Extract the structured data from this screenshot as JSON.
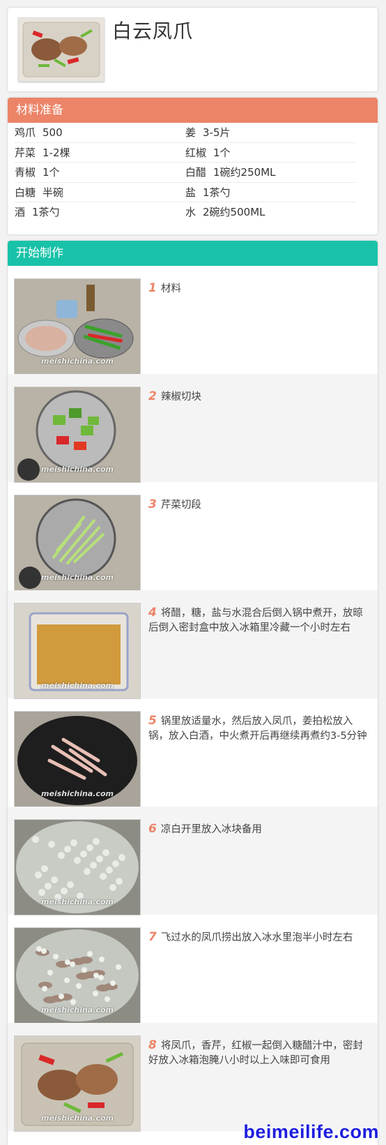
{
  "recipe": {
    "title": "白云凤爪"
  },
  "ingredients": {
    "heading": "材料准备",
    "rows": [
      [
        {
          "name": "鸡爪",
          "amount": "500"
        },
        {
          "name": "姜",
          "amount": "3-5片"
        }
      ],
      [
        {
          "name": "芹菜",
          "amount": "1-2棵"
        },
        {
          "name": "红椒",
          "amount": "1个"
        }
      ],
      [
        {
          "name": "青椒",
          "amount": "1个"
        },
        {
          "name": "白醋",
          "amount": "1碗约250ML"
        }
      ],
      [
        {
          "name": "白糖",
          "amount": "半碗"
        },
        {
          "name": "盐",
          "amount": "1茶勺"
        }
      ],
      [
        {
          "name": "酒",
          "amount": "1茶勺"
        },
        {
          "name": "水",
          "amount": "2碗约500ML"
        }
      ]
    ]
  },
  "steps": {
    "heading": "开始制作",
    "watermark": "meishichina.com",
    "items": [
      {
        "num": "1",
        "text": "材料",
        "scene": "bowls"
      },
      {
        "num": "2",
        "text": "辣椒切块",
        "scene": "peppers"
      },
      {
        "num": "3",
        "text": "芹菜切段",
        "scene": "celery"
      },
      {
        "num": "4",
        "text": "将醋，糖，盐与水混合后倒入锅中煮开，放晾后倒入密封盒中放入冰箱里冷藏一个小时左右",
        "scene": "box"
      },
      {
        "num": "5",
        "text": "锅里放适量水，然后放入凤爪，姜拍松放入锅，放入白酒，中火煮开后再继续再煮约3-5分钟",
        "scene": "wok"
      },
      {
        "num": "6",
        "text": "凉白开里放入冰块备用",
        "scene": "ice"
      },
      {
        "num": "7",
        "text": "飞过水的凤爪捞出放入冰水里泡半小时左右",
        "scene": "icefeet"
      },
      {
        "num": "8",
        "text": "将凤爪，香芹，红椒一起倒入糖醋汁中，密封好放入冰箱泡腌八小时以上入味即可食用",
        "scene": "final"
      }
    ]
  },
  "site_logo": "beimeilife.com",
  "colors": {
    "ingredients_header": "#ec8467",
    "steps_header": "#18c2a8",
    "step_number": "#ec8467",
    "logo": "#1e1ee0"
  }
}
